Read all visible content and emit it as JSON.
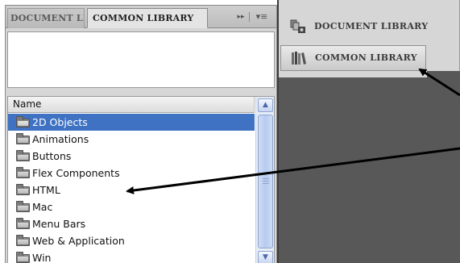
{
  "library_panel": {
    "tabs": [
      {
        "label": "DOCUMENT LIBRARY",
        "active": false
      },
      {
        "label": "COMMON LIBRARY",
        "active": true
      }
    ],
    "collapse_icon": "double-chevron-right-icon",
    "menu_icon": "panel-menu-icon",
    "list": {
      "column_header": "Name",
      "items": [
        {
          "label": "2D Objects",
          "selected": true
        },
        {
          "label": "Animations",
          "selected": false
        },
        {
          "label": "Buttons",
          "selected": false
        },
        {
          "label": "Flex Components",
          "selected": false
        },
        {
          "label": "HTML",
          "selected": false
        },
        {
          "label": "Mac",
          "selected": false
        },
        {
          "label": "Menu Bars",
          "selected": false
        },
        {
          "label": "Web & Application",
          "selected": false
        },
        {
          "label": "Win",
          "selected": false
        }
      ]
    }
  },
  "expanded_panel": {
    "items": [
      {
        "label": "DOCUMENT LIBRARY",
        "icon": "document-library-icon",
        "selected": false
      },
      {
        "label": "COMMON LIBRARY",
        "icon": "common-library-icon",
        "selected": true
      }
    ]
  },
  "colors": {
    "selection": "#3f72c2",
    "panel_bg": "#d6d6d6",
    "dark_area": "#585858",
    "arrow": "#000000"
  }
}
